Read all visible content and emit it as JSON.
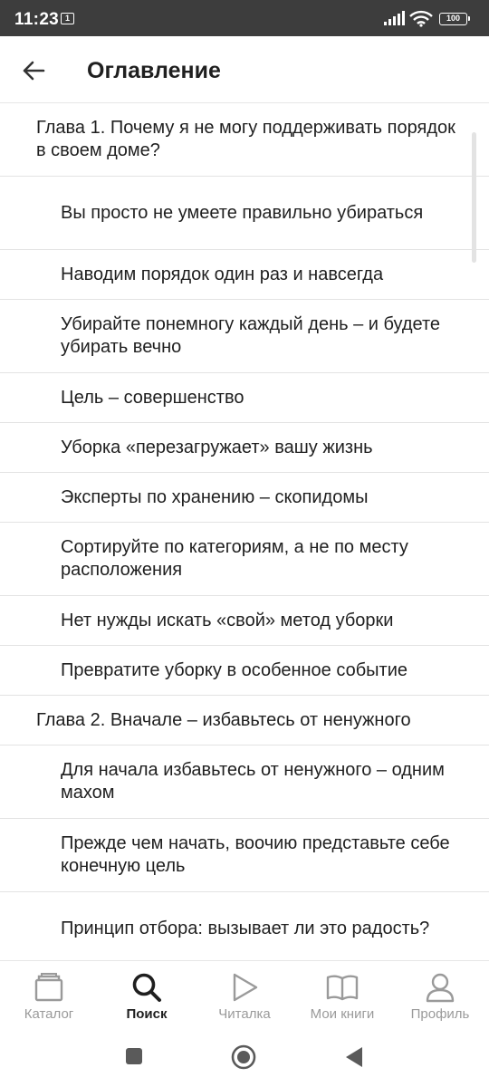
{
  "status_bar": {
    "time": "11:23",
    "notification_badge": "1",
    "battery": "100"
  },
  "header": {
    "title": "Оглавление",
    "back_icon": "arrow-left-icon"
  },
  "toc": [
    {
      "level": "chapter",
      "text": "Глава 1. Почему я не могу поддерживать порядок в своем доме?"
    },
    {
      "level": "section",
      "text": "Вы просто не умеете правильно убираться"
    },
    {
      "level": "section",
      "text": "Наводим порядок один раз и навсегда"
    },
    {
      "level": "section",
      "text": "Убирайте понемногу каждый день – и будете убирать вечно"
    },
    {
      "level": "section",
      "text": "Цель – совершенство"
    },
    {
      "level": "section",
      "text": "Уборка «перезагружает» вашу жизнь"
    },
    {
      "level": "section",
      "text": "Эксперты по хранению – скопидомы"
    },
    {
      "level": "section",
      "text": "Сортируйте по категориям, а не по месту расположения"
    },
    {
      "level": "section",
      "text": "Нет нужды искать «свой» метод уборки"
    },
    {
      "level": "section",
      "text": "Превратите уборку в особенное событие"
    },
    {
      "level": "chapter",
      "text": "Глава 2. Вначале – избавьтесь от ненужного"
    },
    {
      "level": "section",
      "text": "Для начала избавьтесь от ненужного – одним махом"
    },
    {
      "level": "section",
      "text": "Прежде чем начать, воочию представьте себе конечную цель"
    },
    {
      "level": "section",
      "text": "Принцип отбора: вызывает ли это радость?"
    }
  ],
  "bottom_nav": [
    {
      "label": "Каталог",
      "icon": "catalog-icon",
      "active": false
    },
    {
      "label": "Поиск",
      "icon": "search-icon",
      "active": true
    },
    {
      "label": "Читалка",
      "icon": "play-icon",
      "active": false
    },
    {
      "label": "Мои книги",
      "icon": "book-icon",
      "active": false
    },
    {
      "label": "Профиль",
      "icon": "profile-icon",
      "active": false
    }
  ],
  "colors": {
    "status_bar_bg": "#3d3d3d",
    "text_primary": "#1f1f1f",
    "nav_inactive": "#9a9a9a",
    "divider": "#e3e3e3"
  }
}
